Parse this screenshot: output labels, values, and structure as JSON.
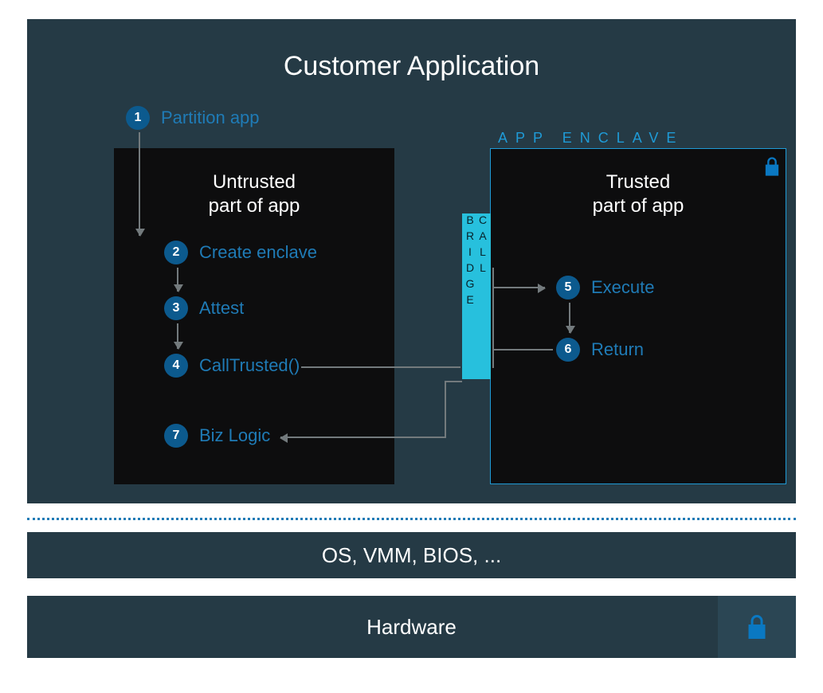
{
  "title": "Customer Application",
  "enclave_label": "APP ENCLAVE",
  "untrusted_head_l1": "Untrusted",
  "untrusted_head_l2": "part of app",
  "trusted_head_l1": "Trusted",
  "trusted_head_l2": "part of app",
  "callbridge": "CALL BRIDGE",
  "steps": {
    "s1": {
      "num": "1",
      "label": "Partition app"
    },
    "s2": {
      "num": "2",
      "label": "Create enclave"
    },
    "s3": {
      "num": "3",
      "label": "Attest"
    },
    "s4": {
      "num": "4",
      "label": "CallTrusted()"
    },
    "s5": {
      "num": "5",
      "label": "Execute"
    },
    "s6": {
      "num": "6",
      "label": "Return"
    },
    "s7": {
      "num": "7",
      "label": "Biz Logic"
    }
  },
  "os_bar": "OS, VMM, BIOS, ...",
  "hw_bar": "Hardware"
}
